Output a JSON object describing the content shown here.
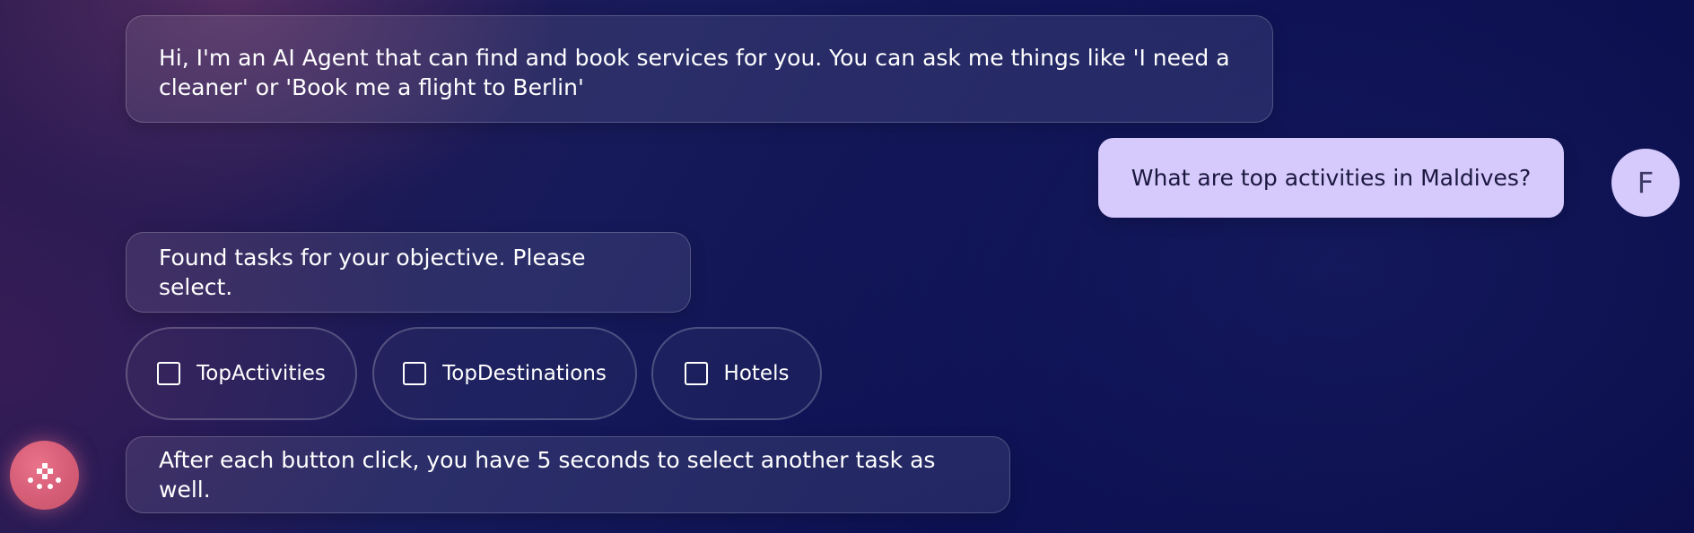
{
  "chat": {
    "messages": {
      "welcome": "Hi, I'm an AI Agent that can find and book services for you. You can ask me things like 'I need a cleaner' or 'Book me a flight to Berlin'",
      "user_query": "What are top activities in Maldives?",
      "found_tasks": "Found tasks for your objective. Please select.",
      "after_click": "After each button click, you have 5 seconds to select another task as well."
    },
    "user_avatar_initial": "F",
    "tasks": [
      {
        "label": "TopActivities",
        "checked": false
      },
      {
        "label": "TopDestinations",
        "checked": false
      },
      {
        "label": "Hotels",
        "checked": false
      }
    ]
  },
  "icons": {
    "launcher": "assistant-logo-icon",
    "checkbox": "checkbox-icon"
  },
  "colors": {
    "user_bubble": "#d6c9fb",
    "launcher": "#e06a82",
    "background": "#0b0f45"
  }
}
